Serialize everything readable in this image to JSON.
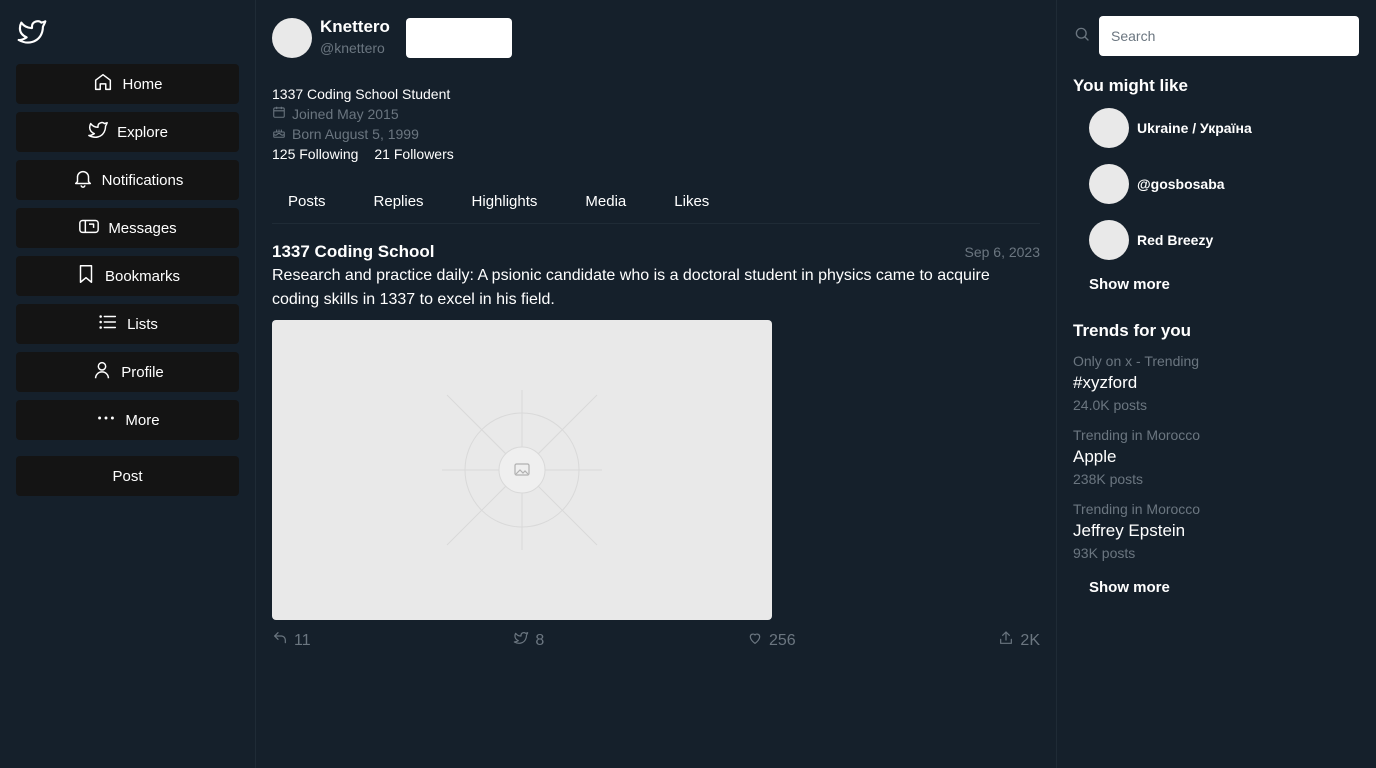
{
  "sidebar": {
    "logo": "bird-icon",
    "items": [
      {
        "label": "Home",
        "icon": "home-icon"
      },
      {
        "label": "Explore",
        "icon": "bird-icon"
      },
      {
        "label": "Notifications",
        "icon": "bell-icon"
      },
      {
        "label": "Messages",
        "icon": "mailbox-icon"
      },
      {
        "label": "Bookmarks",
        "icon": "bookmark-icon"
      },
      {
        "label": "Lists",
        "icon": "list-icon"
      },
      {
        "label": "Profile",
        "icon": "user-icon"
      },
      {
        "label": "More",
        "icon": "dots-icon"
      }
    ],
    "post_label": "Post"
  },
  "profile": {
    "display_name": "Knettero",
    "handle": "@knettero",
    "bio": "1337 Coding School Student",
    "joined": "Joined May 2015",
    "born": "Born August 5, 1999",
    "following": "125 Following",
    "followers": "21 Followers"
  },
  "tabs": [
    "Posts",
    "Replies",
    "Highlights",
    "Media",
    "Likes"
  ],
  "tweet": {
    "author": "1337 Coding School",
    "date": "Sep 6, 2023",
    "text": "Research and practice daily: A psionic candidate who is a doctoral student in physics came to acquire coding skills in 1337 to excel in his field.",
    "replies": "11",
    "retweets": "8",
    "likes": "256",
    "shares": "2K"
  },
  "right": {
    "search_placeholder": "Search",
    "suggest_title": "You might like",
    "suggestions": [
      "Ukraine / Україна",
      "@gosbosaba",
      "Red Breezy"
    ],
    "show_more": "Show more",
    "trends_title": "Trends for you",
    "trends": [
      {
        "context": "Only on x - Trending",
        "name": "#xyzford",
        "count": "24.0K posts"
      },
      {
        "context": "Trending in Morocco",
        "name": "Apple",
        "count": "238K posts"
      },
      {
        "context": "Trending in Morocco",
        "name": "Jeffrey Epstein",
        "count": "93K posts"
      }
    ],
    "trends_show_more": "Show more"
  },
  "colors": {
    "background": "#15202b",
    "button": "#141414",
    "muted": "#6b7680",
    "placeholder": "#e9e9e9"
  }
}
